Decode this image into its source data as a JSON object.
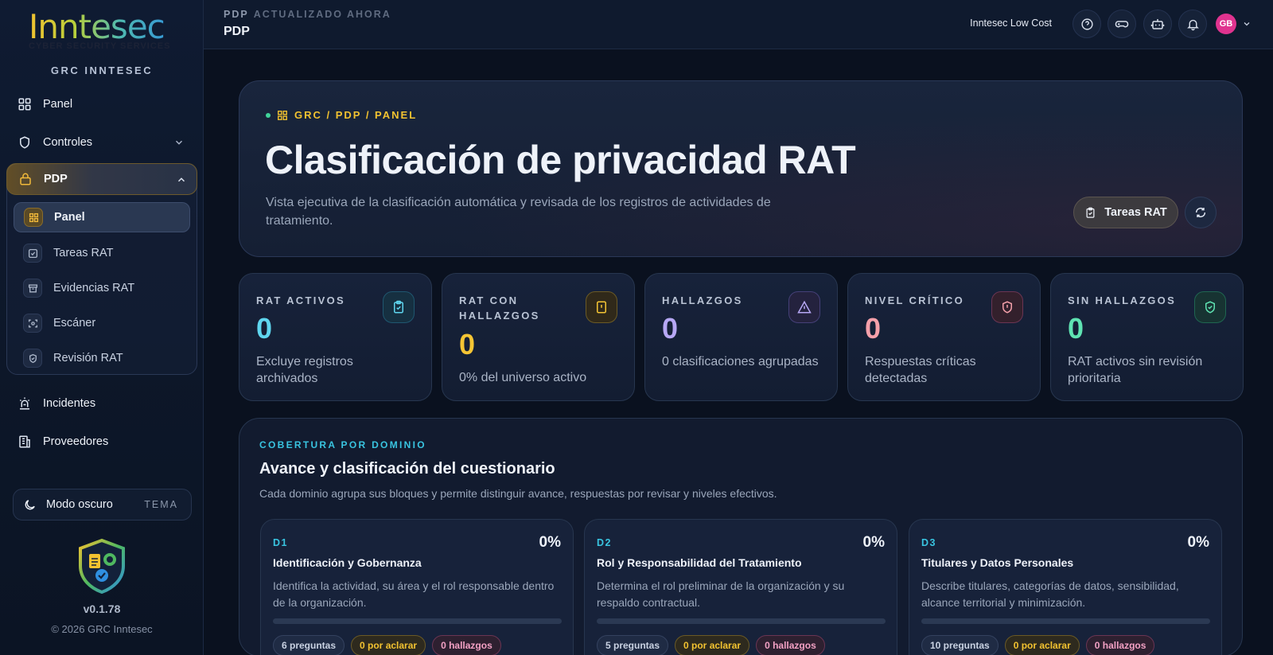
{
  "brand": {
    "logo_text": "Inntesec",
    "logo_subtitle": "CYBER SECURITY SERVICES",
    "caption": "GRC INNTESEC"
  },
  "sidebar": {
    "items": [
      {
        "label": "Panel",
        "icon": "grid-icon"
      },
      {
        "label": "Controles",
        "icon": "shield-icon"
      },
      {
        "label": "PDP",
        "icon": "lock-icon"
      },
      {
        "label": "Incidentes",
        "icon": "siren-icon"
      },
      {
        "label": "Proveedores",
        "icon": "building-icon"
      }
    ],
    "pdp_children": [
      {
        "label": "Panel",
        "icon": "grid-icon",
        "active": true
      },
      {
        "label": "Tareas RAT",
        "icon": "checkbox-icon"
      },
      {
        "label": "Evidencias RAT",
        "icon": "archive-icon"
      },
      {
        "label": "Escáner",
        "icon": "scan-icon"
      },
      {
        "label": "Revisión RAT",
        "icon": "shield-check-icon"
      }
    ],
    "theme": {
      "label": "Modo oscuro",
      "tag": "TEMA"
    },
    "version": "v0.1.78",
    "copyright": "© 2026 GRC Inntesec"
  },
  "topbar": {
    "breadcrumb": "PDP",
    "status": "ACTUALIZADO AHORA",
    "page": "PDP",
    "plan": "Inntesec Low Cost",
    "avatar": "GB"
  },
  "hero": {
    "crumb": "GRC / PDP / PANEL",
    "title": "Clasificación de privacidad RAT",
    "description": "Vista ejecutiva de la clasificación automática y revisada de los registros de actividades de tratamiento.",
    "button": "Tareas RAT"
  },
  "kpis": [
    {
      "label": "RAT ACTIVOS",
      "value": "0",
      "desc": "Excluye registros archivados",
      "color": "#5fd6ef"
    },
    {
      "label": "RAT CON HALLAZGOS",
      "value": "0",
      "desc": "0% del universo activo",
      "color": "#f5c534"
    },
    {
      "label": "HALLAZGOS",
      "value": "0",
      "desc": "0 clasificaciones agrupadas",
      "color": "#b7a8f5"
    },
    {
      "label": "NIVEL CRÍTICO",
      "value": "0",
      "desc": "Respuestas críticas detectadas",
      "color": "#f5a0aa"
    },
    {
      "label": "SIN HALLAZGOS",
      "value": "0",
      "desc": "RAT activos sin revisión prioritaria",
      "color": "#5fe3b2"
    }
  ],
  "coverage": {
    "kicker": "COBERTURA POR DOMINIO",
    "title": "Avance y clasificación del cuestionario",
    "description": "Cada dominio agrupa sus bloques y permite distinguir avance, respuestas por revisar y niveles efectivos.",
    "domains": [
      {
        "code": "D1",
        "pct": "0%",
        "progress": 0,
        "title": "Identificación y Gobernanza",
        "desc": "Identifica la actividad, su área y el rol responsable dentro de la organización.",
        "questions": "6 preguntas",
        "pending": "0 por aclarar",
        "findings": "0 hallazgos"
      },
      {
        "code": "D2",
        "pct": "0%",
        "progress": 0,
        "title": "Rol y Responsabilidad del Tratamiento",
        "desc": "Determina el rol preliminar de la organización y su respaldo contractual.",
        "questions": "5 preguntas",
        "pending": "0 por aclarar",
        "findings": "0 hallazgos"
      },
      {
        "code": "D3",
        "pct": "0%",
        "progress": 0,
        "title": "Titulares y Datos Personales",
        "desc": "Describe titulares, categorías de datos, sensibilidad, alcance territorial y minimización.",
        "questions": "10 preguntas",
        "pending": "0 por aclarar",
        "findings": "0 hallazgos"
      }
    ]
  }
}
